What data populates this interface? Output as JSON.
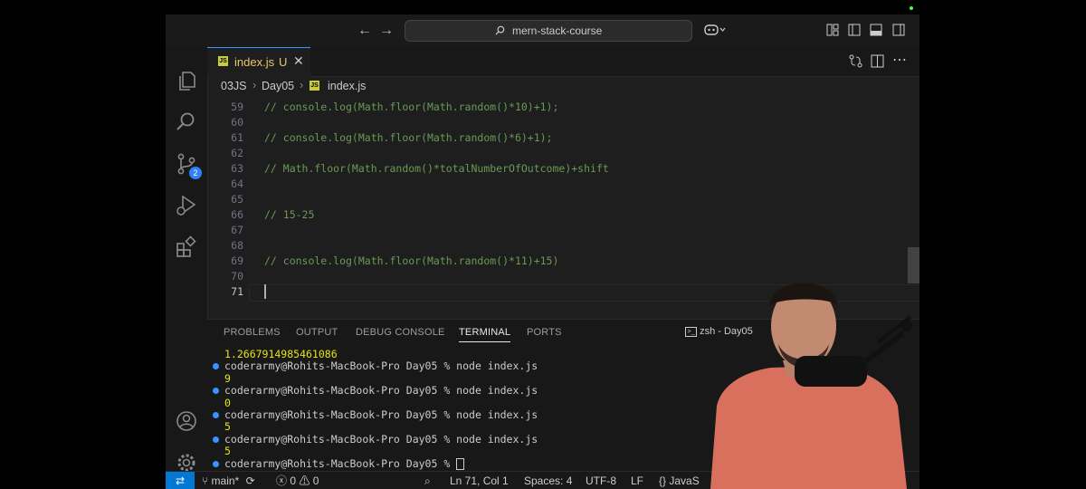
{
  "titlebar": {
    "back_icon": "arrow-left",
    "forward_icon": "arrow-right",
    "search_text": "mern-stack-course",
    "copilot_icon": "copilot"
  },
  "activity_bar": {
    "items": [
      "explorer",
      "search",
      "source-control",
      "run-debug",
      "extensions"
    ],
    "source_control_badge": "2",
    "bottom": [
      "accounts",
      "manage"
    ]
  },
  "editor": {
    "tab": {
      "filename": "index.js",
      "status": "U"
    },
    "breadcrumb": [
      "03JS",
      "Day05",
      "index.js"
    ],
    "lines": [
      {
        "n": "59",
        "text": "// console.log(Math.floor(Math.random()*10)+1);"
      },
      {
        "n": "60",
        "text": ""
      },
      {
        "n": "61",
        "text": "// console.log(Math.floor(Math.random()*6)+1);"
      },
      {
        "n": "62",
        "text": ""
      },
      {
        "n": "63",
        "text": "// Math.floor(Math.random()*totalNumberOfOutcome)+shift"
      },
      {
        "n": "64",
        "text": ""
      },
      {
        "n": "65",
        "text": ""
      },
      {
        "n": "66",
        "text": "// 15-25"
      },
      {
        "n": "67",
        "text": ""
      },
      {
        "n": "68",
        "text": ""
      },
      {
        "n": "69",
        "text": "// console.log(Math.floor(Math.random()*11)+15)"
      },
      {
        "n": "70",
        "text": ""
      },
      {
        "n": "71",
        "text": ""
      }
    ],
    "active_line": "71"
  },
  "panel": {
    "tabs": [
      "PROBLEMS",
      "OUTPUT",
      "DEBUG CONSOLE",
      "TERMINAL",
      "PORTS"
    ],
    "active_tab": "TERMINAL",
    "terminal_label": "zsh - Day05",
    "terminal": [
      {
        "type": "out",
        "text": "1.2667914985461086"
      },
      {
        "type": "cmd",
        "text": "coderarmy@Rohits-MacBook-Pro Day05 % node index.js"
      },
      {
        "type": "out",
        "text": "9"
      },
      {
        "type": "cmd",
        "text": "coderarmy@Rohits-MacBook-Pro Day05 % node index.js"
      },
      {
        "type": "out",
        "text": "0"
      },
      {
        "type": "cmd",
        "text": "coderarmy@Rohits-MacBook-Pro Day05 % node index.js"
      },
      {
        "type": "out",
        "text": "5"
      },
      {
        "type": "cmd",
        "text": "coderarmy@Rohits-MacBook-Pro Day05 % node index.js"
      },
      {
        "type": "out",
        "text": "5"
      },
      {
        "type": "prompt",
        "text": "coderarmy@Rohits-MacBook-Pro Day05 % "
      }
    ]
  },
  "statusbar": {
    "branch": "main*",
    "errors": "0",
    "warnings": "0",
    "position": "Ln 71, Col 1",
    "spaces": "Spaces: 4",
    "encoding": "UTF-8",
    "eol": "LF",
    "language": "JavaS"
  },
  "colors": {
    "accent": "#0078d4",
    "comment": "#6a9955",
    "terminal_output": "#e5e510"
  }
}
